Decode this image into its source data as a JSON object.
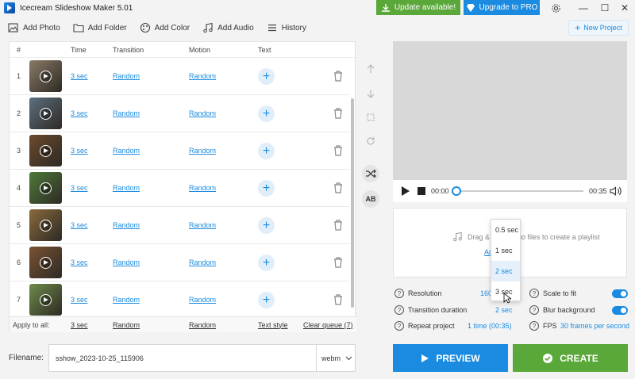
{
  "app": {
    "title": "Icecream Slideshow Maker 5.01"
  },
  "titlebar": {
    "update_label": "Update available!",
    "pro_label": "Upgrade to PRO"
  },
  "toolbar": {
    "add_photo": "Add Photo",
    "add_folder": "Add Folder",
    "add_color": "Add Color",
    "add_audio": "Add Audio",
    "history": "History",
    "new_project": "New Project"
  },
  "table": {
    "headers": {
      "num": "#",
      "time": "Time",
      "transition": "Transition",
      "motion": "Motion",
      "text": "Text"
    },
    "rows": [
      {
        "num": "1",
        "time": "3 sec",
        "transition": "Random",
        "motion": "Random",
        "thumb_color": "#8a7b67"
      },
      {
        "num": "2",
        "time": "3 sec",
        "transition": "Random",
        "motion": "Random",
        "thumb_color": "#5d6f7e"
      },
      {
        "num": "3",
        "time": "3 sec",
        "transition": "Random",
        "motion": "Random",
        "thumb_color": "#6b4a2e"
      },
      {
        "num": "4",
        "time": "3 sec",
        "transition": "Random",
        "motion": "Random",
        "thumb_color": "#4f7a3a"
      },
      {
        "num": "5",
        "time": "3 sec",
        "transition": "Random",
        "motion": "Random",
        "thumb_color": "#8a6a3c"
      },
      {
        "num": "6",
        "time": "3 sec",
        "transition": "Random",
        "motion": "Random",
        "thumb_color": "#7a5232"
      },
      {
        "num": "7",
        "time": "3 sec",
        "transition": "Random",
        "motion": "Random",
        "thumb_color": "#6e8b4a"
      }
    ],
    "footer": {
      "apply_label": "Apply to all:",
      "time": "3 sec",
      "transition": "Random",
      "motion": "Random",
      "text_style": "Text style",
      "clear_queue": "Clear queue (7)"
    }
  },
  "player": {
    "current_time": "00:00",
    "total_time": "00:35",
    "progress": 0
  },
  "audio": {
    "drag_text": "Drag & drop audio files to create a playlist",
    "add_audio_link": "Add audio"
  },
  "settings": {
    "resolution_label": "Resolution",
    "resolution_value": "1600x900",
    "transition_label": "Transition duration",
    "transition_value": "2 sec",
    "repeat_label": "Repeat project",
    "repeat_value": "1 time (00:35)",
    "scale_label": "Scale to fit",
    "blur_label": "Blur background",
    "fps_label": "FPS",
    "fps_value": "30 frames per second"
  },
  "dropdown": {
    "options": [
      "0.5 sec",
      "1 sec",
      "2 sec",
      "3 sec"
    ],
    "selected": "2 sec"
  },
  "bottom": {
    "filename_label": "Filename:",
    "filename_value": "sshow_2023-10-25_115906",
    "format": "webm",
    "preview_label": "PREVIEW",
    "create_label": "CREATE"
  },
  "colors": {
    "accent": "#1a8be0",
    "green": "#5aa73a"
  }
}
